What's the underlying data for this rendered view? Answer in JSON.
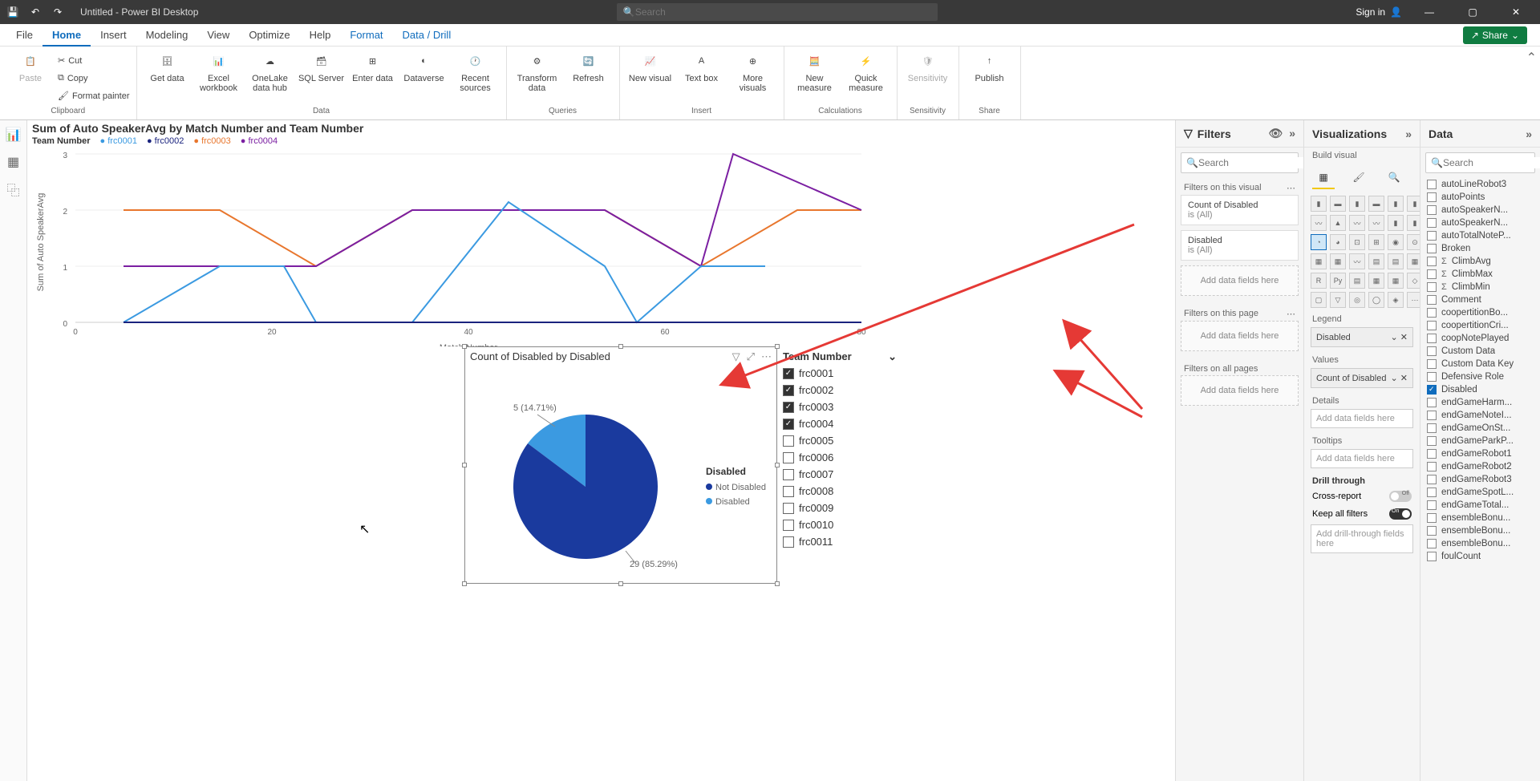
{
  "titlebar": {
    "title": "Untitled - Power BI Desktop",
    "search_placeholder": "Search",
    "signin": "Sign in"
  },
  "ribbon_tabs": [
    "File",
    "Home",
    "Insert",
    "Modeling",
    "View",
    "Optimize",
    "Help",
    "Format",
    "Data / Drill"
  ],
  "ribbon_active": "Home",
  "share_label": "Share",
  "ribbon": {
    "clipboard": {
      "paste": "Paste",
      "cut": "Cut",
      "copy": "Copy",
      "format_painter": "Format painter",
      "group": "Clipboard"
    },
    "data": {
      "get_data": "Get data",
      "excel": "Excel workbook",
      "onelake": "OneLake data hub",
      "sql": "SQL Server",
      "enter": "Enter data",
      "dataverse": "Dataverse",
      "recent": "Recent sources",
      "group": "Data"
    },
    "queries": {
      "transform": "Transform data",
      "refresh": "Refresh",
      "group": "Queries"
    },
    "insert": {
      "new_visual": "New visual",
      "text_box": "Text box",
      "more_visuals": "More visuals",
      "group": "Insert"
    },
    "calc": {
      "new_measure": "New measure",
      "quick_measure": "Quick measure",
      "group": "Calculations"
    },
    "sensitivity": {
      "sensitivity": "Sensitivity",
      "group": "Sensitivity"
    },
    "share": {
      "publish": "Publish",
      "group": "Share"
    }
  },
  "line_chart": {
    "title": "Sum of Auto SpeakerAvg by Match Number and Team Number",
    "legend_label": "Team Number",
    "legend": [
      "frc0001",
      "frc0002",
      "frc0003",
      "frc0004"
    ],
    "xlabel": "Match Number",
    "ylabel": "Sum of Auto SpeakerAvg"
  },
  "pie_chart": {
    "title": "Count of Disabled by Disabled",
    "slice1_label": "5 (14.71%)",
    "slice2_label": "29 (85.29%)",
    "legend_title": "Disabled",
    "legend": [
      "Not Disabled",
      "Disabled"
    ]
  },
  "slicer": {
    "title": "Team Number",
    "items": [
      {
        "label": "frc0001",
        "checked": true
      },
      {
        "label": "frc0002",
        "checked": true
      },
      {
        "label": "frc0003",
        "checked": true
      },
      {
        "label": "frc0004",
        "checked": true
      },
      {
        "label": "frc0005",
        "checked": false
      },
      {
        "label": "frc0006",
        "checked": false
      },
      {
        "label": "frc0007",
        "checked": false
      },
      {
        "label": "frc0008",
        "checked": false
      },
      {
        "label": "frc0009",
        "checked": false
      },
      {
        "label": "frc0010",
        "checked": false
      },
      {
        "label": "frc0011",
        "checked": false
      }
    ]
  },
  "filters": {
    "header": "Filters",
    "search_placeholder": "Search",
    "on_visual": "Filters on this visual",
    "cards": [
      {
        "name": "Count of Disabled",
        "detail": "is (All)"
      },
      {
        "name": "Disabled",
        "detail": "is (All)"
      }
    ],
    "add_visual": "Add data fields here",
    "on_page": "Filters on this page",
    "add_page": "Add data fields here",
    "on_all": "Filters on all pages",
    "add_all": "Add data fields here"
  },
  "viz": {
    "header": "Visualizations",
    "build": "Build visual",
    "legend": "Legend",
    "legend_val": "Disabled",
    "values": "Values",
    "values_val": "Count of Disabled",
    "details": "Details",
    "details_ph": "Add data fields here",
    "tooltips": "Tooltips",
    "tooltips_ph": "Add data fields here",
    "drill": "Drill through",
    "cross": "Cross-report",
    "cross_state": "Off",
    "keep": "Keep all filters",
    "keep_state": "On",
    "drill_ph": "Add drill-through fields here"
  },
  "data": {
    "header": "Data",
    "search_placeholder": "Search",
    "fields": [
      {
        "name": "autoLineRobot3",
        "sigma": false,
        "checked": false
      },
      {
        "name": "autoPoints",
        "sigma": false,
        "checked": false
      },
      {
        "name": "autoSpeakerN...",
        "sigma": false,
        "checked": false
      },
      {
        "name": "autoSpeakerN...",
        "sigma": false,
        "checked": false
      },
      {
        "name": "autoTotalNoteP...",
        "sigma": false,
        "checked": false
      },
      {
        "name": "Broken",
        "sigma": false,
        "checked": false
      },
      {
        "name": "ClimbAvg",
        "sigma": true,
        "checked": false
      },
      {
        "name": "ClimbMax",
        "sigma": true,
        "checked": false
      },
      {
        "name": "ClimbMin",
        "sigma": true,
        "checked": false
      },
      {
        "name": "Comment",
        "sigma": false,
        "checked": false
      },
      {
        "name": "coopertitionBo...",
        "sigma": false,
        "checked": false
      },
      {
        "name": "coopertitionCri...",
        "sigma": false,
        "checked": false
      },
      {
        "name": "coopNotePlayed",
        "sigma": false,
        "checked": false
      },
      {
        "name": "Custom Data",
        "sigma": false,
        "checked": false
      },
      {
        "name": "Custom Data Key",
        "sigma": false,
        "checked": false
      },
      {
        "name": "Defensive Role",
        "sigma": false,
        "checked": false
      },
      {
        "name": "Disabled",
        "sigma": false,
        "checked": true
      },
      {
        "name": "endGameHarm...",
        "sigma": false,
        "checked": false
      },
      {
        "name": "endGameNoteI...",
        "sigma": false,
        "checked": false
      },
      {
        "name": "endGameOnSt...",
        "sigma": false,
        "checked": false
      },
      {
        "name": "endGameParkP...",
        "sigma": false,
        "checked": false
      },
      {
        "name": "endGameRobot1",
        "sigma": false,
        "checked": false
      },
      {
        "name": "endGameRobot2",
        "sigma": false,
        "checked": false
      },
      {
        "name": "endGameRobot3",
        "sigma": false,
        "checked": false
      },
      {
        "name": "endGameSpotL...",
        "sigma": false,
        "checked": false
      },
      {
        "name": "endGameTotal...",
        "sigma": false,
        "checked": false
      },
      {
        "name": "ensembleBonu...",
        "sigma": false,
        "checked": false
      },
      {
        "name": "ensembleBonu...",
        "sigma": false,
        "checked": false
      },
      {
        "name": "ensembleBonu...",
        "sigma": false,
        "checked": false
      },
      {
        "name": "foulCount",
        "sigma": false,
        "checked": false
      }
    ]
  },
  "chart_data": [
    {
      "type": "line",
      "title": "Sum of Auto SpeakerAvg by Match Number and Team Number",
      "xlabel": "Match Number",
      "ylabel": "Sum of Auto SpeakerAvg",
      "x": [
        0,
        20,
        40,
        60,
        80
      ],
      "ylim": [
        0,
        3
      ],
      "series": [
        {
          "name": "frc0001",
          "color": "#3b9ae1",
          "values": [
            0,
            1,
            0,
            2,
            1,
            0,
            1,
            1,
            1
          ]
        },
        {
          "name": "frc0002",
          "color": "#1a237e",
          "values": [
            0,
            0,
            0,
            0,
            0,
            0,
            0,
            0,
            0
          ]
        },
        {
          "name": "frc0003",
          "color": "#e8762d",
          "values": [
            2,
            2,
            1,
            2,
            2,
            2,
            1,
            2,
            2
          ]
        },
        {
          "name": "frc0004",
          "color": "#7b1fa2",
          "values": [
            1,
            1,
            1,
            2,
            2,
            2,
            1,
            3,
            2
          ]
        }
      ]
    },
    {
      "type": "pie",
      "title": "Count of Disabled by Disabled",
      "categories": [
        "Not Disabled",
        "Disabled"
      ],
      "values": [
        29,
        5
      ],
      "percentages": [
        85.29,
        14.71
      ],
      "colors": [
        "#1a3a9e",
        "#3b9ae1"
      ]
    }
  ]
}
